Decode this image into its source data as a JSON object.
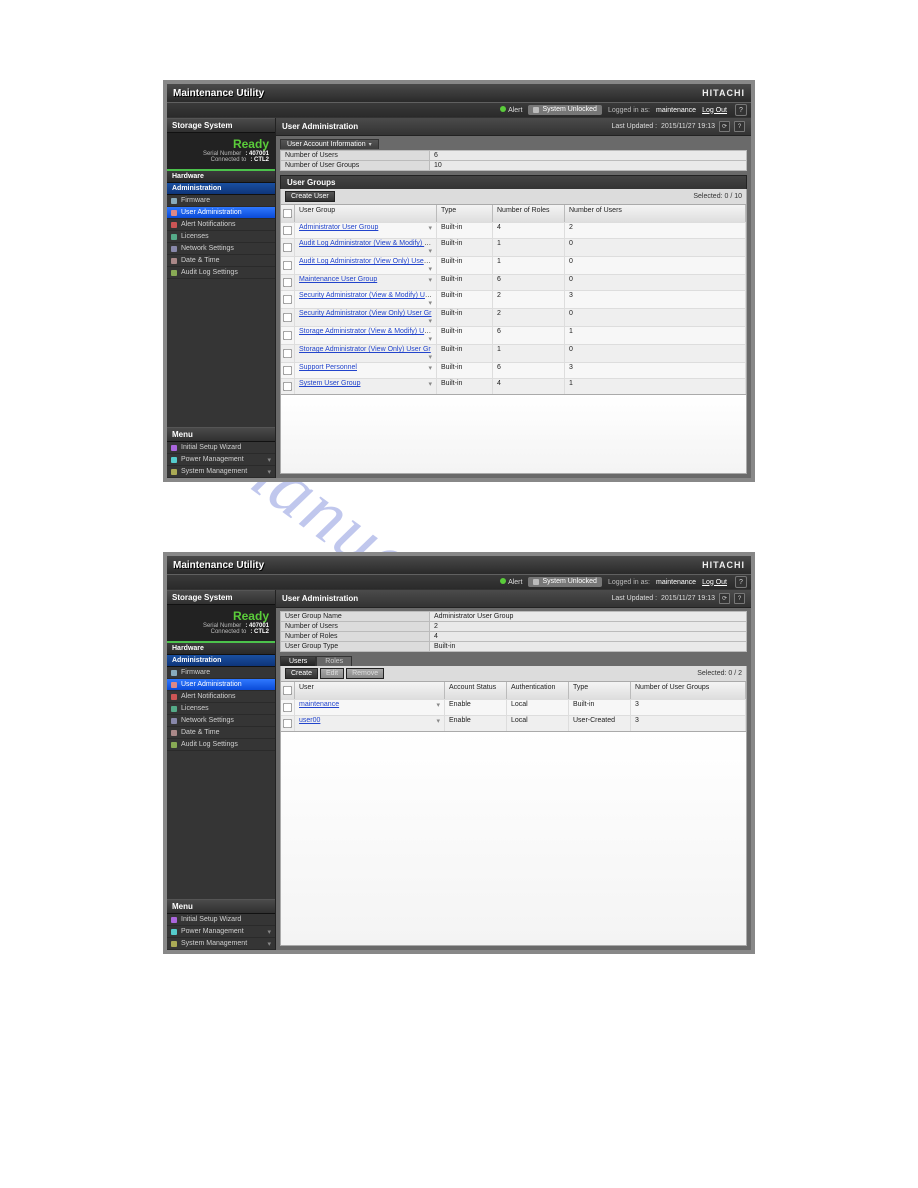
{
  "app_title": "Maintenance Utility",
  "brand": "HITACHI",
  "topbar": {
    "alert": "Alert",
    "unlocked": "System Unlocked",
    "logged_in_label": "Logged in as:",
    "user": "maintenance",
    "logout": "Log Out",
    "help": "?"
  },
  "sidebar": {
    "storage_system": "Storage System",
    "status": "Ready",
    "serial_k": "Serial Number",
    "serial_v": ": 407001",
    "conn_k": "Connected to",
    "conn_v": ": CTL2",
    "hardware": "Hardware",
    "administration": "Administration",
    "items": [
      {
        "label": "Firmware",
        "cls": "i-fw"
      },
      {
        "label": "User Administration",
        "cls": "i-user",
        "sel": true
      },
      {
        "label": "Alert Notifications",
        "cls": "i-alert"
      },
      {
        "label": "Licenses",
        "cls": "i-lic"
      },
      {
        "label": "Network Settings",
        "cls": "i-net"
      },
      {
        "label": "Date & Time",
        "cls": "i-date"
      },
      {
        "label": "Audit Log Settings",
        "cls": "i-log"
      }
    ],
    "menu": "Menu",
    "menu_items": [
      {
        "label": "Initial Setup Wizard",
        "cls": "i-wiz"
      },
      {
        "label": "Power Management",
        "cls": "i-pwr",
        "caret": true
      },
      {
        "label": "System Management",
        "cls": "i-sys",
        "caret": true
      }
    ]
  },
  "screen1": {
    "breadcrumb": "User Administration",
    "last_updated_label": "Last Updated :",
    "last_updated": "2015/11/27 19:13",
    "acct_tab": "User Account Information",
    "info": [
      {
        "k": "Number of Users",
        "v": "6"
      },
      {
        "k": "Number of User Groups",
        "v": "10"
      }
    ],
    "section": "User Groups",
    "create_btn": "Create User",
    "selected": "Selected: 0 / 10",
    "headers": [
      "User Group",
      "Type",
      "Number of Roles",
      "Number of Users"
    ],
    "rows": [
      {
        "g": "Administrator User Group",
        "t": "Built-in",
        "r": "4",
        "u": "2"
      },
      {
        "g": "Audit Log Administrator (View & Modify) Us",
        "t": "Built-in",
        "r": "1",
        "u": "0"
      },
      {
        "g": "Audit Log Administrator (View Only) User G",
        "t": "Built-in",
        "r": "1",
        "u": "0"
      },
      {
        "g": "Maintenance User Group",
        "t": "Built-in",
        "r": "6",
        "u": "0"
      },
      {
        "g": "Security Administrator (View & Modify) User",
        "t": "Built-in",
        "r": "2",
        "u": "3"
      },
      {
        "g": "Security Administrator (View Only) User Gr",
        "t": "Built-in",
        "r": "2",
        "u": "0"
      },
      {
        "g": "Storage Administrator (View & Modify) User",
        "t": "Built-in",
        "r": "6",
        "u": "1"
      },
      {
        "g": "Storage Administrator (View Only) User Gr",
        "t": "Built-in",
        "r": "1",
        "u": "0"
      },
      {
        "g": "Support Personnel",
        "t": "Built-in",
        "r": "6",
        "u": "3"
      },
      {
        "g": "System User Group",
        "t": "Built-in",
        "r": "4",
        "u": "1"
      }
    ]
  },
  "screen2": {
    "breadcrumb": "User Administration",
    "last_updated_label": "Last Updated :",
    "last_updated": "2015/11/27 19:13",
    "info": [
      {
        "k": "User Group Name",
        "v": "Administrator User Group"
      },
      {
        "k": "Number of Users",
        "v": "2"
      },
      {
        "k": "Number of Roles",
        "v": "4"
      },
      {
        "k": "User Group Type",
        "v": "Built-in"
      }
    ],
    "tab_users": "Users",
    "tab_roles": "Roles",
    "create_btn": "Create",
    "edit_btn": "Edit",
    "remove_btn": "Remove",
    "selected": "Selected: 0 / 2",
    "headers": [
      "User",
      "Account Status",
      "Authentication",
      "Type",
      "Number of User Groups"
    ],
    "rows": [
      {
        "u": "maintenance",
        "s": "Enable",
        "a": "Local",
        "t": "Built-in",
        "n": "3"
      },
      {
        "u": "user00",
        "s": "Enable",
        "a": "Local",
        "t": "User-Created",
        "n": "3"
      }
    ]
  },
  "watermark": "manualshive.com"
}
